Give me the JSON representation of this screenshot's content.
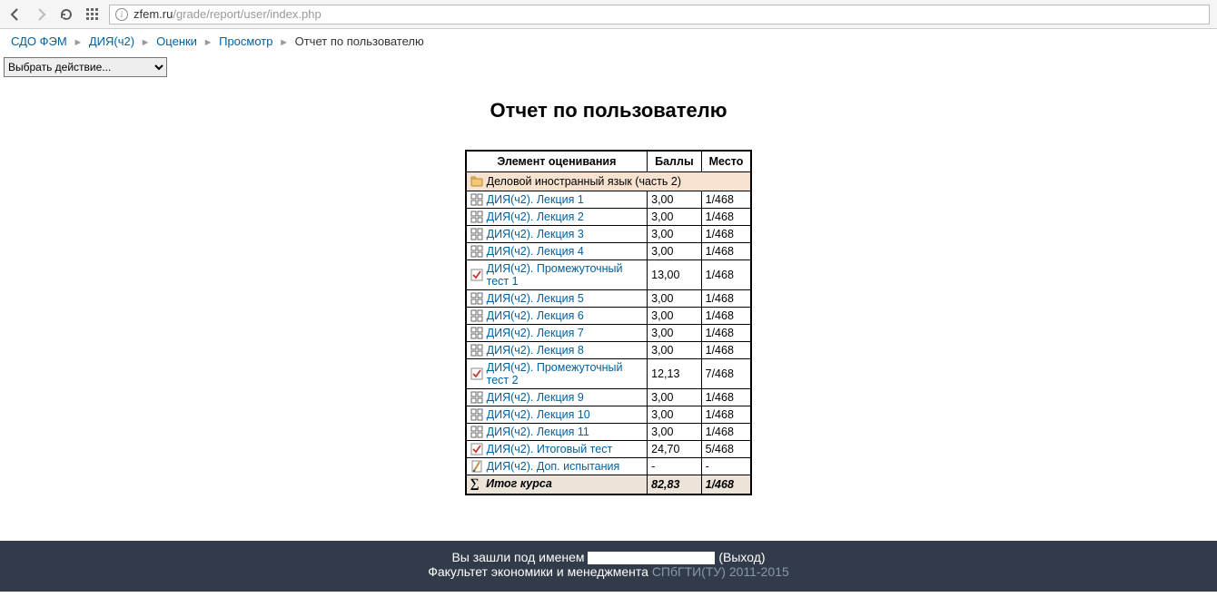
{
  "browser": {
    "url_host": "zfem.ru",
    "url_path": "/grade/report/user/index.php"
  },
  "breadcrumbs": {
    "items": [
      {
        "label": "СДО ФЭМ"
      },
      {
        "label": "ДИЯ(ч2)"
      },
      {
        "label": "Оценки"
      },
      {
        "label": "Просмотр"
      }
    ],
    "current": "Отчет по пользователю"
  },
  "action_select": {
    "placeholder": "Выбрать действие..."
  },
  "page_title": "Отчет по пользователю",
  "table": {
    "headers": {
      "item": "Элемент оценивания",
      "score": "Баллы",
      "rank": "Место"
    },
    "course": "Деловой иностранный язык (часть 2)",
    "rows": [
      {
        "type": "lesson",
        "label": "ДИЯ(ч2). Лекция 1",
        "score": "3,00",
        "rank": "1/468"
      },
      {
        "type": "lesson",
        "label": "ДИЯ(ч2). Лекция 2",
        "score": "3,00",
        "rank": "1/468"
      },
      {
        "type": "lesson",
        "label": "ДИЯ(ч2). Лекция 3",
        "score": "3,00",
        "rank": "1/468"
      },
      {
        "type": "lesson",
        "label": "ДИЯ(ч2). Лекция 4",
        "score": "3,00",
        "rank": "1/468"
      },
      {
        "type": "quiz",
        "label": "ДИЯ(ч2). Промежуточный тест 1",
        "score": "13,00",
        "rank": "1/468"
      },
      {
        "type": "lesson",
        "label": "ДИЯ(ч2). Лекция 5",
        "score": "3,00",
        "rank": "1/468"
      },
      {
        "type": "lesson",
        "label": "ДИЯ(ч2). Лекция 6",
        "score": "3,00",
        "rank": "1/468"
      },
      {
        "type": "lesson",
        "label": "ДИЯ(ч2). Лекция 7",
        "score": "3,00",
        "rank": "1/468"
      },
      {
        "type": "lesson",
        "label": "ДИЯ(ч2). Лекция 8",
        "score": "3,00",
        "rank": "1/468"
      },
      {
        "type": "quiz",
        "label": "ДИЯ(ч2). Промежуточный тест 2",
        "score": "12,13",
        "rank": "7/468"
      },
      {
        "type": "lesson",
        "label": "ДИЯ(ч2). Лекция 9",
        "score": "3,00",
        "rank": "1/468"
      },
      {
        "type": "lesson",
        "label": "ДИЯ(ч2). Лекция 10",
        "score": "3,00",
        "rank": "1/468"
      },
      {
        "type": "lesson",
        "label": "ДИЯ(ч2). Лекция 11",
        "score": "3,00",
        "rank": "1/468"
      },
      {
        "type": "quiz",
        "label": "ДИЯ(ч2). Итоговый тест",
        "score": "24,70",
        "rank": "5/468"
      },
      {
        "type": "assign",
        "label": "ДИЯ(ч2). Доп. испытания",
        "score": "-",
        "rank": "-"
      }
    ],
    "total": {
      "label": "Итог курса",
      "score": "82,83",
      "rank": "1/468"
    }
  },
  "footer": {
    "logged_in_prefix": "Вы зашли под именем ",
    "logout": "(Выход)",
    "faculty": "Факультет экономики и менеджмента ",
    "org": "СПбГТИ(ТУ) 2011-2015"
  }
}
